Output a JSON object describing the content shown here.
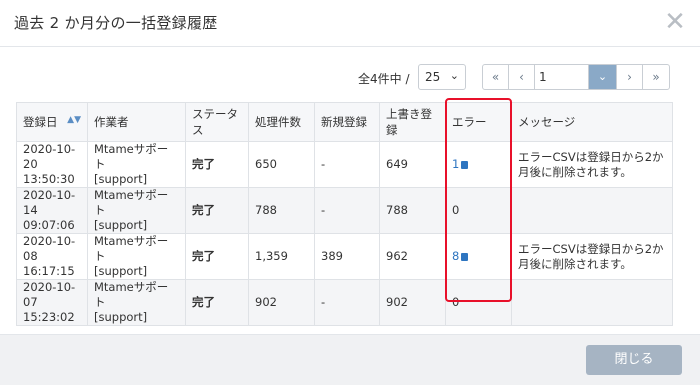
{
  "header": {
    "title": "過去 2 か月分の一括登録履歴",
    "close_symbol": "✕"
  },
  "pager": {
    "total_label": "全4件中 /",
    "page_size": "25",
    "first": "«",
    "prev": "‹",
    "current_page": "1",
    "next": "›",
    "last": "»"
  },
  "table": {
    "headers": {
      "date": "登録日",
      "worker": "作業者",
      "status": "ステータス",
      "processed": "処理件数",
      "new": "新規登録",
      "overwrite": "上書き登録",
      "error": "エラー",
      "message": "メッセージ"
    },
    "rows": [
      {
        "date": "2020-10-20",
        "time": "13:50:30",
        "worker": "Mtameサポート",
        "worker_id": "[support]",
        "status": "完了",
        "processed": "650",
        "new": "-",
        "overwrite": "649",
        "error": "1",
        "message": "エラーCSVは登録日から2か月後に削除されます。"
      },
      {
        "date": "2020-10-14",
        "time": "09:07:06",
        "worker": "Mtameサポート",
        "worker_id": "[support]",
        "status": "完了",
        "processed": "788",
        "new": "-",
        "overwrite": "788",
        "error": "0",
        "message": ""
      },
      {
        "date": "2020-10-08",
        "time": "16:17:15",
        "worker": "Mtameサポート",
        "worker_id": "[support]",
        "status": "完了",
        "processed": "1,359",
        "new": "389",
        "overwrite": "962",
        "error": "8",
        "message": "エラーCSVは登録日から2か月後に削除されます。"
      },
      {
        "date": "2020-10-07",
        "time": "15:23:02",
        "worker": "Mtameサポート",
        "worker_id": "[support]",
        "status": "完了",
        "processed": "902",
        "new": "-",
        "overwrite": "902",
        "error": "0",
        "message": ""
      }
    ]
  },
  "footer": {
    "close_label": "閉じる"
  },
  "colors": {
    "highlight": "#e8102a",
    "link": "#2e75c0",
    "button": "#a6b4c3"
  }
}
